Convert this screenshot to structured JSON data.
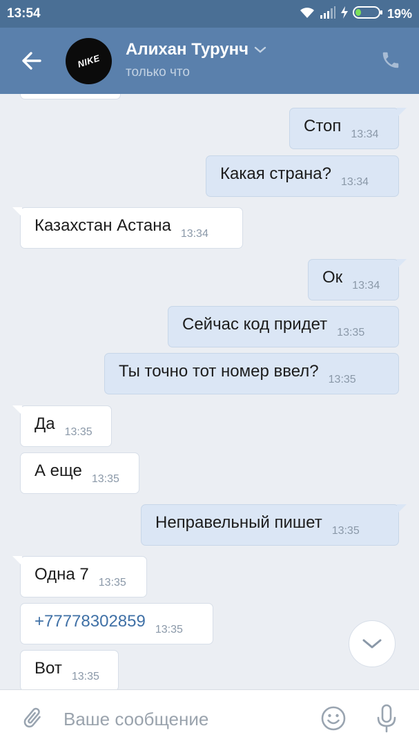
{
  "status_bar": {
    "time": "13:54",
    "battery_percent": "19%",
    "icons": [
      "wifi-icon",
      "signal-icon",
      "charging-icon",
      "battery-icon"
    ]
  },
  "header": {
    "contact_name": "Алихан Турунч",
    "contact_status": "только что",
    "avatar_text": "NIKE",
    "icons": [
      "back-arrow-icon",
      "chevron-down-icon",
      "phone-icon"
    ]
  },
  "messages": [
    {
      "dir": "out",
      "text": "Стоп",
      "time": "13:34"
    },
    {
      "dir": "out",
      "text": "Какая страна?",
      "time": "13:34"
    },
    {
      "dir": "in",
      "text": "Казахстан Астана",
      "time": "13:34"
    },
    {
      "dir": "out",
      "text": "Ок",
      "time": "13:34"
    },
    {
      "dir": "out",
      "text": "Сейчас код придет",
      "time": "13:35"
    },
    {
      "dir": "out",
      "text": "Ты точно тот номер ввел?",
      "time": "13:35"
    },
    {
      "dir": "in",
      "text": "Да",
      "time": "13:35"
    },
    {
      "dir": "in",
      "text": "А еще",
      "time": "13:35"
    },
    {
      "dir": "out",
      "text": "Неправельный пишет",
      "time": "13:35"
    },
    {
      "dir": "in",
      "text": "Одна 7",
      "time": "13:35"
    },
    {
      "dir": "in",
      "text": "+77778302859",
      "time": "13:35",
      "link": true
    },
    {
      "dir": "in",
      "text": "Вот",
      "time": "13:35"
    }
  ],
  "composer": {
    "placeholder": "Ваше сообщение",
    "icons": [
      "paperclip-icon",
      "emoji-icon",
      "microphone-icon"
    ]
  },
  "colors": {
    "status_bar": "#4a6f95",
    "header": "#5a80ac",
    "background": "#ebeef3",
    "bubble_in": "#ffffff",
    "bubble_out": "#dbe6f5",
    "link": "#3f70a6"
  }
}
